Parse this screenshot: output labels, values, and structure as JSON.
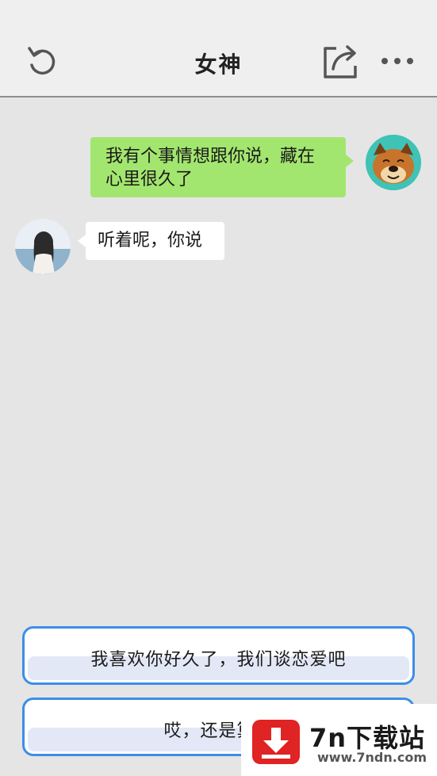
{
  "header": {
    "title": "女神",
    "back_icon": "refresh-back-icon",
    "share_icon": "share-icon",
    "more_icon": "more-icon"
  },
  "messages": [
    {
      "from": "me",
      "text_line1": "我有个事情想跟你说，藏在",
      "text_line2": "心里很久了",
      "bubble_color": "#a3e66f"
    },
    {
      "from": "her",
      "text": "听着呢，你说",
      "bubble_color": "#ffffff"
    }
  ],
  "choices": [
    {
      "label": "我喜欢你好久了，我们谈恋爱吧"
    },
    {
      "label": "哎，还是算了"
    }
  ],
  "watermark": {
    "brand": "7n下载站",
    "url": "www.7ndn.com",
    "icon": "download-arrow-icon",
    "color": "#e02323"
  },
  "colors": {
    "accent": "#3d8ee8",
    "background": "#e5e5e5",
    "my_bubble": "#a3e66f"
  }
}
